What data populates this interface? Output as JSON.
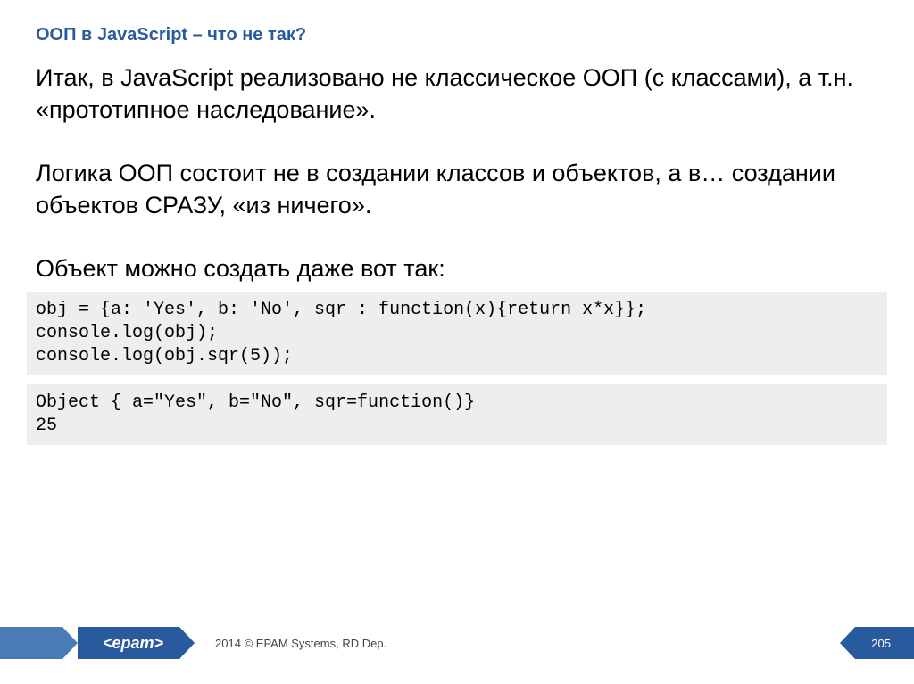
{
  "title": "ООП в JavaScript – что не так?",
  "paragraphs": {
    "p1": "Итак, в JavaScript реализовано не классическое ООП (с классами), а т.н. «прототипное наследование».",
    "p2": "Логика ООП состоит не в создании классов и объектов, а в… создании объектов СРАЗУ, «из ничего».",
    "p3": "Объект можно создать даже вот так:"
  },
  "code": {
    "input": "obj = {a: 'Yes', b: 'No', sqr : function(x){return x*x}};\nconsole.log(obj);\nconsole.log(obj.sqr(5));",
    "output": "Object { a=\"Yes\", b=\"No\", sqr=function()}\n25"
  },
  "footer": {
    "logo": "<epam>",
    "copyright": "2014 © EPAM Systems, RD Dep.",
    "page": "205"
  }
}
